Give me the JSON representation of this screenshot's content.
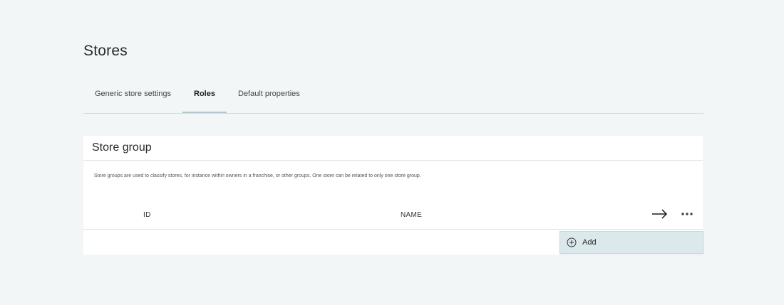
{
  "page": {
    "title": "Stores"
  },
  "tabs": [
    {
      "label": "Generic store settings",
      "active": false
    },
    {
      "label": "Roles",
      "active": true
    },
    {
      "label": "Default properties",
      "active": false
    }
  ],
  "card": {
    "title": "Store group",
    "description": "Store groups are used to classify stores, for instance within owners in a franchise, or other groups. One store can be related to only one store group.",
    "table": {
      "columns": [
        "ID",
        "NAME"
      ],
      "rows": []
    },
    "icons": {
      "arrow": "arrow-right-icon",
      "more": "more-horizontal-icon"
    }
  },
  "dropdown": {
    "items": [
      {
        "label": "Add",
        "icon": "add-circle-icon"
      }
    ]
  },
  "colors": {
    "background": "#f3f6f7",
    "card": "#ffffff",
    "active_tab_indicator": "#a9cbd3",
    "dropdown_bg": "#dbe9ed"
  }
}
